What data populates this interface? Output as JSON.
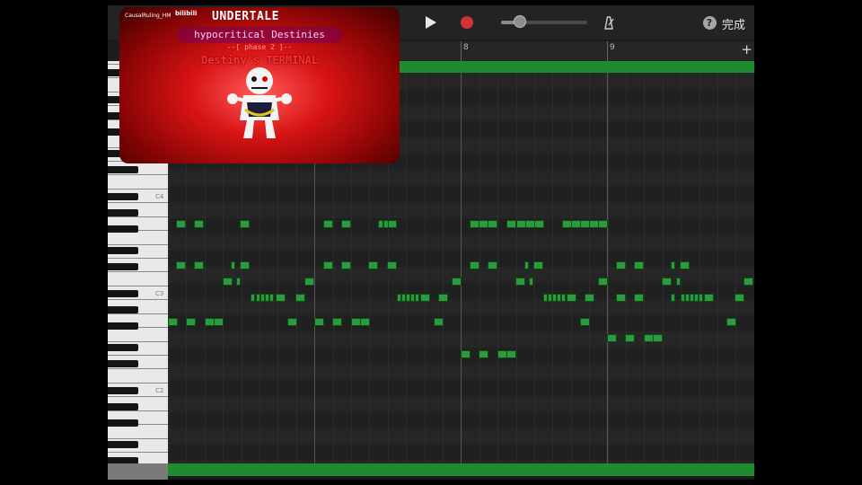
{
  "toolbar": {
    "done_label": "完成",
    "help_label": "?",
    "icons": [
      "play-icon",
      "record-icon",
      "metronome-icon",
      "help-icon"
    ],
    "volume_level": 0.22,
    "colors": {
      "record": "#d0343a",
      "region": "#1f8a2e",
      "note": "#2d9a3f"
    }
  },
  "ruler": {
    "bars": [
      {
        "label": "8"
      },
      {
        "label": "9"
      }
    ],
    "add_label": "+"
  },
  "keyboard": {
    "octave_labels": [
      "C4",
      "C3",
      "C2"
    ]
  },
  "video": {
    "uploader": "CausalRuling_HM",
    "site": "bilibili",
    "title": "UNDERTALE",
    "subtitle": "hypocritical Destinies",
    "phase": "--[ phase 2 ]--",
    "caption": "Destiny's TERMINAL"
  }
}
